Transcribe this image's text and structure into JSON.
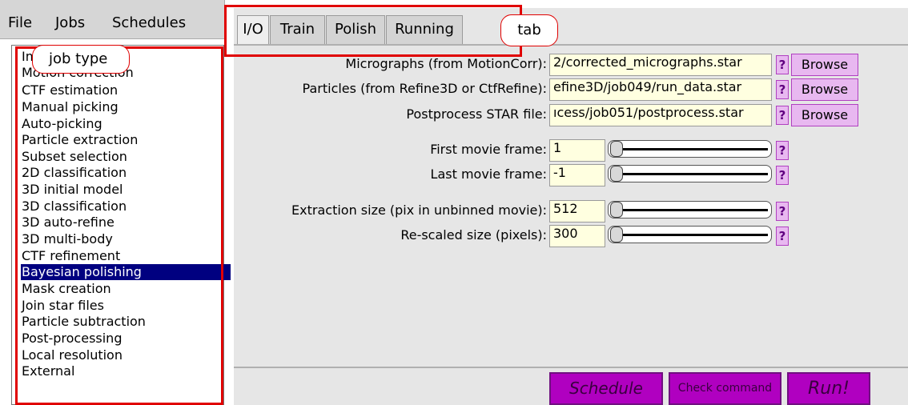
{
  "menu": {
    "file": "File",
    "jobs": "Jobs",
    "schedules": "Schedules"
  },
  "annotations": {
    "job_type": "job type",
    "tab": "tab"
  },
  "job_types": [
    "Import",
    "Motion correction",
    "CTF estimation",
    "Manual picking",
    "Auto-picking",
    "Particle extraction",
    "Subset selection",
    "2D classification",
    "3D initial model",
    "3D classification",
    "3D auto-refine",
    "3D multi-body",
    "CTF refinement",
    "Bayesian polishing",
    "Mask creation",
    "Join star files",
    "Particle subtraction",
    "Post-processing",
    "Local resolution",
    "External"
  ],
  "selected_job": "Bayesian polishing",
  "tabs": [
    "I/O",
    "Train",
    "Polish",
    "Running"
  ],
  "active_tab": "I/O",
  "fields": {
    "micrographs": {
      "label": "Micrographs (from MotionCorr):",
      "value": "2/corrected_micrographs.star"
    },
    "particles": {
      "label": "Particles (from Refine3D or CtfRefine):",
      "value": "efine3D/job049/run_data.star"
    },
    "postprocess": {
      "label": "Postprocess STAR file:",
      "value": "ıcess/job051/postprocess.star"
    },
    "first_frame": {
      "label": "First movie frame:",
      "value": "1"
    },
    "last_frame": {
      "label": "Last movie frame:",
      "value": "-1"
    },
    "extract_size": {
      "label": "Extraction size (pix in unbinned movie):",
      "value": "512"
    },
    "rescaled_size": {
      "label": "Re-scaled size (pixels):",
      "value": "300"
    }
  },
  "help_label": "?",
  "browse_label": "Browse",
  "buttons": {
    "schedule": "Schedule",
    "check": "Check command",
    "run": "Run!"
  },
  "colors": {
    "selection": "#000080",
    "button": "#b000c0",
    "input_bg": "#ffffe0",
    "annotation": "#e00000"
  }
}
